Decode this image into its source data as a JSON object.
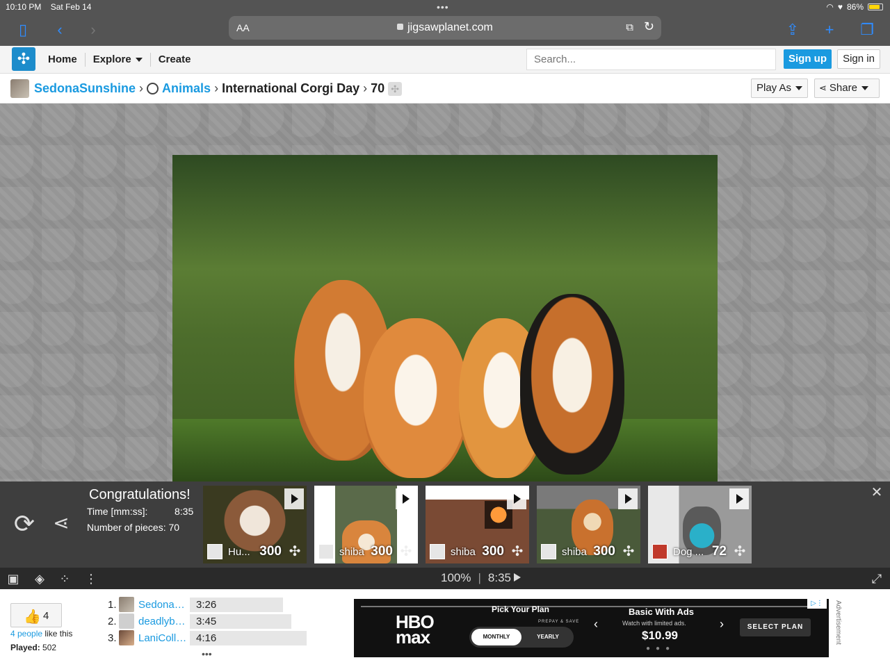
{
  "status_bar": {
    "time": "10:10 PM",
    "date": "Sat Feb 14",
    "battery": "86%",
    "battery_level": 0.86
  },
  "browser": {
    "text_size": "AA",
    "url": "jigsawplanet.com"
  },
  "site": {
    "nav": [
      "Home",
      "Explore",
      "Create"
    ],
    "search_placeholder": "Search...",
    "signup": "Sign up",
    "signin": "Sign in"
  },
  "breadcrumb": {
    "user": "SedonaSunshine",
    "category": "Animals",
    "title": "International Corgi Day",
    "pieces": "70",
    "play_as": "Play As",
    "share": "Share"
  },
  "congrats": {
    "title": "Congratulations!",
    "time_label": "Time [mm:ss]:",
    "time_value": "8:35",
    "pieces_label": "Number of pieces: 70"
  },
  "related": [
    {
      "label": "Hu...",
      "count": "300"
    },
    {
      "label": "shiba",
      "count": "300"
    },
    {
      "label": "shiba",
      "count": "300"
    },
    {
      "label": "shiba",
      "count": "300"
    },
    {
      "label": "Dog ...",
      "count": "72"
    }
  ],
  "toolbar": {
    "zoom": "100%",
    "timer": "8:35"
  },
  "likes": {
    "count": "4",
    "people_link": "4 people",
    "like_suffix": "like this",
    "played_label": "Played:",
    "played_value": "502"
  },
  "leaderboard": [
    {
      "rank": "1.",
      "name": "SedonaSunshine",
      "time": "3:26",
      "bar": 0.8
    },
    {
      "rank": "2.",
      "name": "deadlybeauty",
      "time": "3:45",
      "bar": 0.87
    },
    {
      "rank": "3.",
      "name": "LaniCollins",
      "time": "4:16",
      "bar": 1.0
    }
  ],
  "ad": {
    "pick_plan": "Pick Your Plan",
    "prepay": "PREPAY & SAVE",
    "monthly": "MONTHLY",
    "yearly": "YEARLY",
    "plan_name": "Basic With Ads",
    "plan_desc": "Watch with limited ads.",
    "price": "$10.99",
    "select": "SELECT PLAN",
    "label": "Advertisement"
  },
  "icons": {
    "sidebar": "sidebar-icon",
    "back": "chevron-left-icon",
    "forward": "chevron-right-icon",
    "share": "share-icon",
    "new_tab": "plus-icon",
    "tabs": "tabs-icon",
    "replay": "replay-icon",
    "close": "close-icon",
    "image": "image-icon",
    "ghost": "ghost-icon",
    "pieces_grid": "grid-icon",
    "menu": "more-vertical-icon",
    "fullscreen": "fullscreen-icon",
    "like": "thumbs-up-icon"
  },
  "colors": {
    "accent": "#1a9ae0",
    "chrome": "#545454",
    "safari_blue": "#2f8cff"
  }
}
